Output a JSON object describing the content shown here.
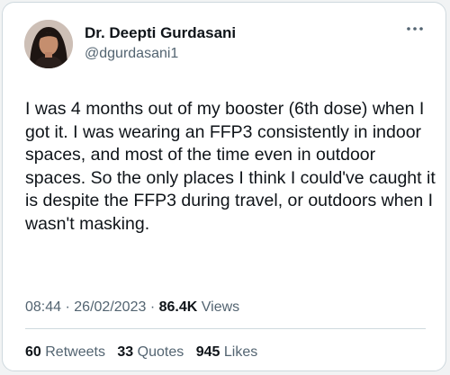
{
  "author": {
    "name": "Dr. Deepti Gurdasani",
    "handle": "@dgurdasani1"
  },
  "tweet": {
    "text": "I was 4 months out of my booster (6th dose) when I got it. I was wearing an FFP3 consistently in indoor spaces, and most of the time even in outdoor spaces. So the only places I think I could've caught it is despite the FFP3 during travel, or outdoors when I wasn't masking."
  },
  "meta": {
    "time": "08:44",
    "separator": "·",
    "date": "26/02/2023",
    "views_count": "86.4K",
    "views_label": "Views"
  },
  "stats": {
    "retweets_count": "60",
    "retweets_label": "Retweets",
    "quotes_count": "33",
    "quotes_label": "Quotes",
    "likes_count": "945",
    "likes_label": "Likes"
  },
  "icons": {
    "more": "more-options-icon",
    "avatar": "profile-photo"
  },
  "colors": {
    "text_primary": "#0f1419",
    "text_secondary": "#536471",
    "border": "#cfd9de"
  }
}
